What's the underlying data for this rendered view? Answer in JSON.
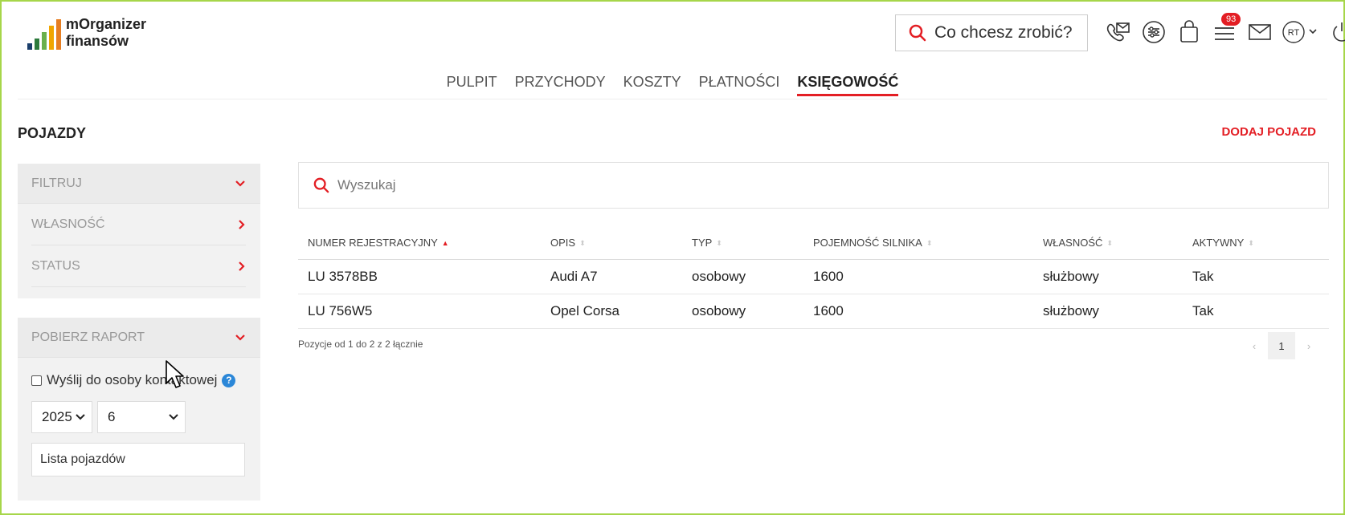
{
  "header": {
    "logo_line1": "mOrganizer",
    "logo_line2": "finansów",
    "search_placeholder": "Co chcesz zrobić?",
    "notification_count": "93",
    "user_initials": "RT"
  },
  "nav": {
    "items": [
      "PULPIT",
      "PRZYCHODY",
      "KOSZTY",
      "PŁATNOŚCI",
      "KSIĘGOWOŚĆ"
    ],
    "active": "KSIĘGOWOŚĆ"
  },
  "page": {
    "title": "POJAZDY",
    "add_button": "DODAJ POJAZD"
  },
  "sidebar": {
    "filter_label": "FILTRUJ",
    "ownership_label": "WŁASNOŚĆ",
    "status_label": "STATUS",
    "report_label": "POBIERZ RAPORT",
    "send_checkbox_label": "Wyślij do osoby kontaktowej",
    "send_checked": false,
    "year_value": "2025",
    "month_value": "6",
    "report_type_value": "Lista pojazdów"
  },
  "main": {
    "search_placeholder": "Wyszukaj",
    "columns": [
      "NUMER REJESTRACYJNY",
      "OPIS",
      "TYP",
      "POJEMNOŚĆ SILNIKA",
      "WŁASNOŚĆ",
      "AKTYWNY"
    ],
    "rows": [
      [
        "LU 3578BB",
        "Audi A7",
        "osobowy",
        "1600",
        "służbowy",
        "Tak"
      ],
      [
        "LU 756W5",
        "Opel Corsa",
        "osobowy",
        "1600",
        "służbowy",
        "Tak"
      ]
    ],
    "pagination_info": "Pozycje od 1 do 2 z 2 łącznie",
    "current_page": "1"
  },
  "colors": {
    "accent": "#e31e24",
    "frame": "#a6d64a",
    "info_blue": "#2b87d8"
  }
}
